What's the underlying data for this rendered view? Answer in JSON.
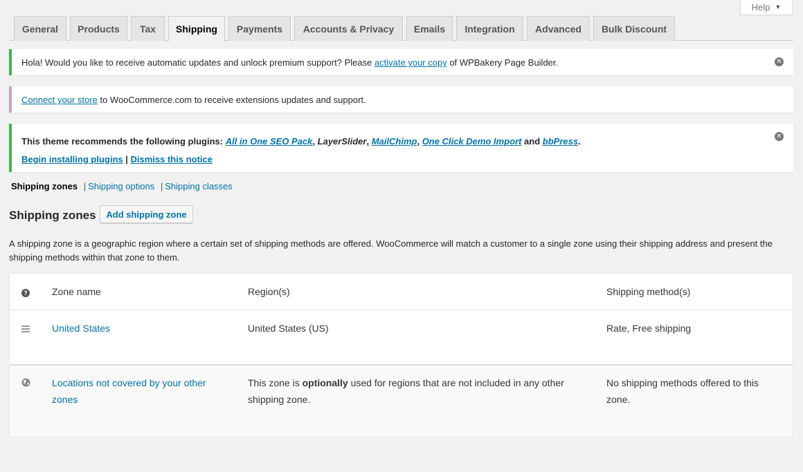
{
  "help": {
    "label": "Help"
  },
  "tabs": [
    {
      "label": "General"
    },
    {
      "label": "Products"
    },
    {
      "label": "Tax"
    },
    {
      "label": "Shipping",
      "active": true
    },
    {
      "label": "Payments"
    },
    {
      "label": "Accounts & Privacy"
    },
    {
      "label": "Emails"
    },
    {
      "label": "Integration"
    },
    {
      "label": "Advanced"
    },
    {
      "label": "Bulk Discount"
    }
  ],
  "notices": {
    "wpbakery": {
      "pre": "Hola! Would you like to receive automatic updates and unlock premium support? Please ",
      "link": "activate your copy",
      "post": " of WPBakery Page Builder."
    },
    "woocommerce": {
      "link": "Connect your store",
      "post": " to WooCommerce.com to receive extensions updates and support."
    },
    "plugins": {
      "intro": "This theme recommends the following plugins: ",
      "p1": "All in One SEO Pack",
      "sep1": ", ",
      "p2": "LayerSlider",
      "sep2": ", ",
      "p3": "MailChimp",
      "sep3": ", ",
      "p4": "One Click Demo Import",
      "and": " and ",
      "p5": "bbPress",
      "end": ".",
      "begin": "Begin installing plugins",
      "bar": " | ",
      "dismiss": "Dismiss this notice"
    }
  },
  "subnav": {
    "current": "Shipping zones",
    "sep": "|",
    "options": "Shipping options",
    "classes": "Shipping classes"
  },
  "heading": "Shipping zones",
  "add_zone_button": "Add shipping zone",
  "description": "A shipping zone is a geographic region where a certain set of shipping methods are offered. WooCommerce will match a customer to a single zone using their shipping address and present the shipping methods within that zone to them.",
  "table": {
    "headers": {
      "name": "Zone name",
      "regions": "Region(s)",
      "methods": "Shipping method(s)"
    },
    "rows": [
      {
        "name": "United States",
        "regions": "United States (US)",
        "methods": "Rate, Free shipping"
      }
    ],
    "rest": {
      "name": "Locations not covered by your other zones",
      "region_pre": "This zone is ",
      "region_bold": "optionally",
      "region_post": " used for regions that are not included in any other shipping zone.",
      "methods": "No shipping methods offered to this zone."
    }
  },
  "colors": {
    "link": "#0073aa",
    "notice_green": "#46b450",
    "notice_purple": "#c9a0c6",
    "background": "#f1f1f1"
  }
}
